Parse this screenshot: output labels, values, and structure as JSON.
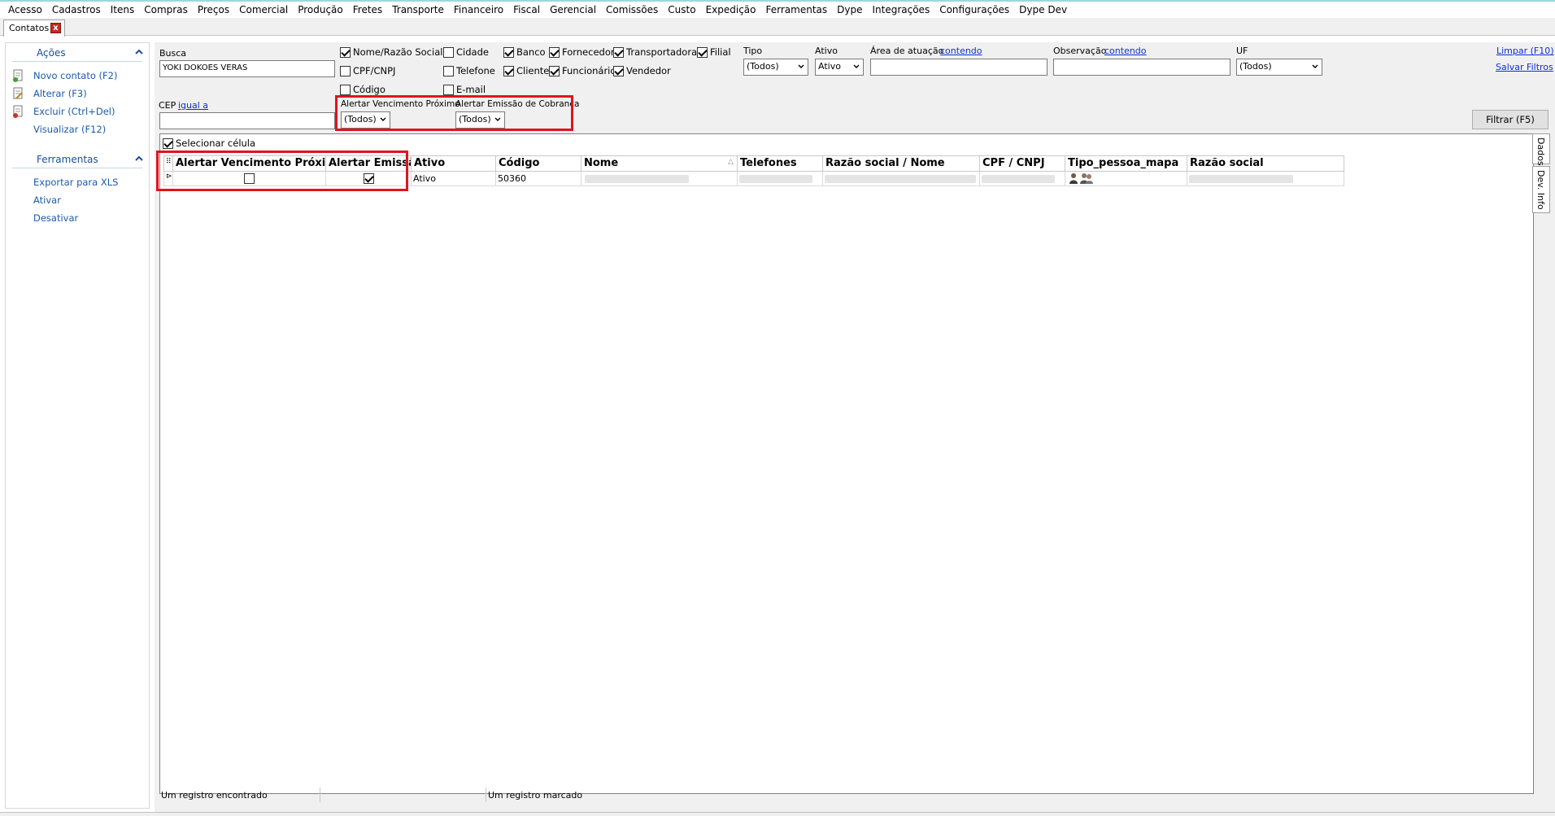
{
  "menu": [
    "Acesso",
    "Cadastros",
    "Itens",
    "Compras",
    "Preços",
    "Comercial",
    "Produção",
    "Fretes",
    "Transporte",
    "Financeiro",
    "Fiscal",
    "Gerencial",
    "Comissões",
    "Custo",
    "Expedição",
    "Ferramentas",
    "Dype",
    "Integrações",
    "Configurações",
    "Dype Dev"
  ],
  "tab": {
    "label": "Contatos",
    "close": "x"
  },
  "sidebar": {
    "acoes": {
      "title": "Ações",
      "items": [
        "Novo contato (F2)",
        "Alterar (F3)",
        "Excluir (Ctrl+Del)",
        "Visualizar (F12)"
      ]
    },
    "ferramentas": {
      "title": "Ferramentas",
      "items": [
        "Exportar para XLS",
        "Ativar",
        "Desativar"
      ]
    }
  },
  "filters": {
    "busca_label": "Busca",
    "busca_value": "YOKI DOKOES VERAS",
    "cep_label": "CEP",
    "cep_mode": "igual a",
    "checks": {
      "nome": {
        "label": "Nome/Razão Social",
        "checked": true
      },
      "cpf": {
        "label": "CPF/CNPJ",
        "checked": false
      },
      "codigo": {
        "label": "Código",
        "checked": false
      },
      "cidade": {
        "label": "Cidade",
        "checked": false
      },
      "telefone": {
        "label": "Telefone",
        "checked": false
      },
      "email": {
        "label": "E-mail",
        "checked": false
      },
      "banco": {
        "label": "Banco",
        "checked": true
      },
      "cliente": {
        "label": "Cliente",
        "checked": true
      },
      "fornecedor": {
        "label": "Fornecedor",
        "checked": true
      },
      "funcionario": {
        "label": "Funcionário",
        "checked": true
      },
      "transportadora": {
        "label": "Transportadora",
        "checked": true
      },
      "vendedor": {
        "label": "Vendedor",
        "checked": true
      },
      "filial": {
        "label": "Filial",
        "checked": true
      }
    },
    "tipo": {
      "label": "Tipo",
      "value": "(Todos)"
    },
    "ativo": {
      "label": "Ativo",
      "value": "Ativo"
    },
    "area": {
      "label": "Área de atuação",
      "mode": "contendo",
      "value": ""
    },
    "observacao": {
      "label": "Observação",
      "mode": "contendo",
      "value": ""
    },
    "uf": {
      "label": "UF",
      "value": "(Todos)"
    },
    "alerta_venc": {
      "label": "Alertar Vencimento Próximo",
      "value": "(Todos)"
    },
    "alerta_emis": {
      "label": "Alertar Emissão de Cobranca",
      "value": "(Todos)"
    },
    "limpar": "Limpar (F10)",
    "salvar": "Salvar Filtros",
    "filtrar": "Filtrar (F5)"
  },
  "grid": {
    "selecionar_celula": "Selecionar célula",
    "columns": [
      "Alertar Vencimento Próximo",
      "Alertar Emissão",
      "Ativo",
      "Código",
      "Nome",
      "Telefones",
      "Razão social / Nome",
      "CPF / CNPJ",
      "Tipo_pessoa_mapa",
      "Razão social"
    ],
    "rows": [
      {
        "alerta_venc": false,
        "alerta_emis": true,
        "ativo": "Ativo",
        "codigo": "50360",
        "nome": "",
        "telefones": "",
        "razao_nome": "",
        "cpf": "",
        "razao": ""
      }
    ]
  },
  "side_tabs": [
    "Dados",
    "Dev. Info"
  ],
  "status": {
    "left": "Um registro encontrado",
    "middle": "",
    "right": "Um registro marcado"
  },
  "colors": {
    "accent_link": "#0b2fd8",
    "highlight": "#e0141e",
    "sidebar_link": "#1a5bb0"
  }
}
